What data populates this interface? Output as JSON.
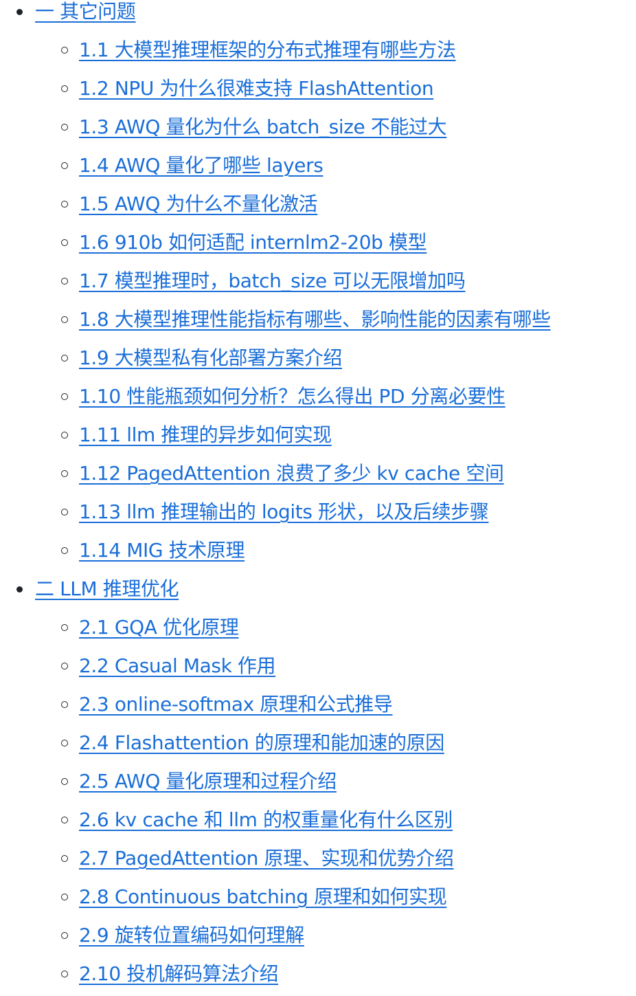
{
  "toc": {
    "sections": [
      {
        "title": "一 其它问题",
        "items": [
          "1.1 大模型推理框架的分布式推理有哪些方法",
          "1.2 NPU 为什么很难支持 FlashAttention",
          "1.3 AWQ 量化为什么 batch_size 不能过大",
          "1.4 AWQ 量化了哪些 layers",
          "1.5 AWQ 为什么不量化激活",
          "1.6 910b 如何适配 internlm2-20b 模型",
          "1.7 模型推理时，batch_size 可以无限增加吗",
          "1.8 大模型推理性能指标有哪些、影响性能的因素有哪些",
          "1.9 大模型私有化部署方案介绍",
          "1.10 性能瓶颈如何分析？怎么得出 PD 分离必要性",
          "1.11 llm 推理的异步如何实现",
          "1.12 PagedAttention 浪费了多少 kv cache 空间",
          "1.13 llm 推理输出的 logits 形状，以及后续步骤",
          "1.14 MIG 技术原理"
        ]
      },
      {
        "title": "二 LLM 推理优化",
        "items": [
          "2.1 GQA 优化原理",
          "2.2 Casual Mask 作用",
          "2.3 online-softmax 原理和公式推导",
          "2.4 Flashattention 的原理和能加速的原因",
          "2.5 AWQ 量化原理和过程介绍",
          "2.6 kv cache 和 llm 的权重量化有什么区别",
          "2.7 PagedAttention 原理、实现和优势介绍",
          "2.8 Continuous batching 原理和如何实现",
          "2.9 旋转位置编码如何理解",
          "2.10 投机解码算法介绍"
        ]
      }
    ]
  },
  "colors": {
    "link": "#1a6ed8",
    "bullet": "#1f2328",
    "background": "#ffffff"
  }
}
